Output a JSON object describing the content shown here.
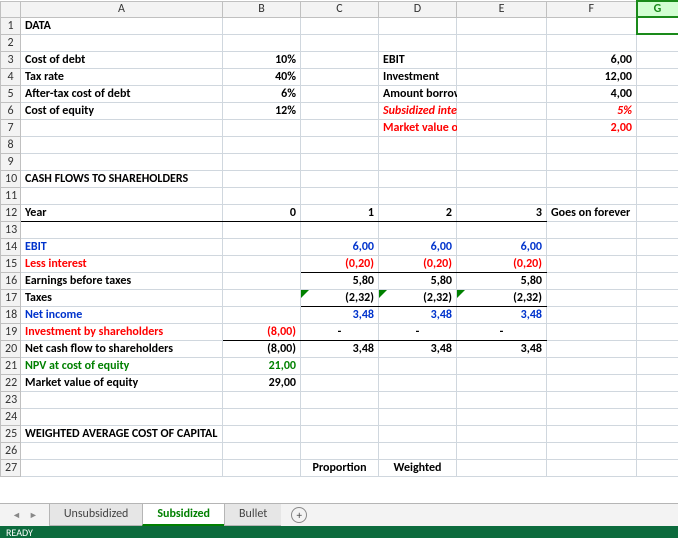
{
  "column_headers": [
    "A",
    "B",
    "C",
    "D",
    "E",
    "F",
    "G"
  ],
  "rows": {
    "1": {
      "A": "DATA"
    },
    "3": {
      "A": "Cost of debt",
      "B": "10%",
      "D": "EBIT",
      "F": "6,00"
    },
    "4": {
      "A": "Tax rate",
      "B": "40%",
      "D": "Investment",
      "F": "12,00"
    },
    "5": {
      "A": "After-tax cost of debt",
      "B": "6%",
      "D": "Amount borrowed",
      "F": "4,00"
    },
    "6": {
      "A": "Cost of equity",
      "B": "12%",
      "D": "Subsidized interest rate",
      "F": "5%"
    },
    "7": {
      "D": "Market value of debt",
      "F": "2,00"
    },
    "10": {
      "A": "CASH FLOWS TO SHAREHOLDERS"
    },
    "12": {
      "A": "Year",
      "B": "0",
      "C": "1",
      "D": "2",
      "E": "3",
      "F": "Goes on forever"
    },
    "14": {
      "A": "EBIT",
      "C": "6,00",
      "D": "6,00",
      "E": "6,00"
    },
    "15": {
      "A": "Less interest",
      "C": "(0,20)",
      "D": "(0,20)",
      "E": "(0,20)"
    },
    "16": {
      "A": "Earnings before taxes",
      "C": "5,80",
      "D": "5,80",
      "E": "5,80"
    },
    "17": {
      "A": "Taxes",
      "C": "(2,32)",
      "D": "(2,32)",
      "E": "(2,32)"
    },
    "18": {
      "A": "Net income",
      "C": "3,48",
      "D": "3,48",
      "E": "3,48"
    },
    "19": {
      "A": "Investment by shareholders",
      "B": "(8,00)",
      "C": "-",
      "D": "-",
      "E": "-"
    },
    "20": {
      "A": "Net cash flow to shareholders",
      "B": "(8,00)",
      "C": "3,48",
      "D": "3,48",
      "E": "3,48"
    },
    "21": {
      "A": "NPV at cost of equity",
      "B": "21,00"
    },
    "22": {
      "A": "Market value of equity",
      "B": "29,00"
    },
    "25": {
      "A": "WEIGHTED AVERAGE COST OF CAPITAL"
    },
    "27": {
      "C": "Proportion",
      "D": "Weighted"
    }
  },
  "tabs": [
    "Unsubsidized",
    "Subsidized",
    "Bullet"
  ],
  "active_tab": "Subsidized",
  "status": "READY"
}
